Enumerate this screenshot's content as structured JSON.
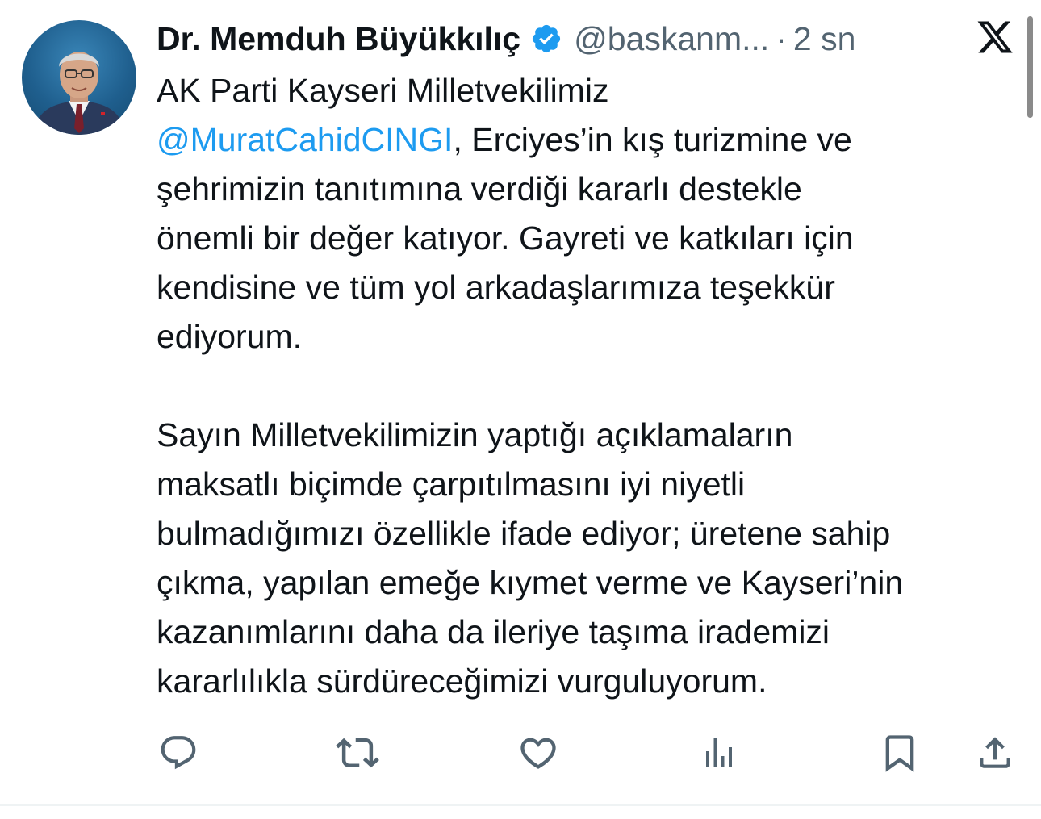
{
  "tweet": {
    "author": {
      "display_name": "Dr. Memduh Büyükkılıç",
      "handle": "@baskanm...",
      "separator": "·",
      "time": "2 sn"
    },
    "lines": {
      "l1": "AK Parti Kayseri Milletvekilimiz",
      "l2_mention": "@MuratCahidCINGI",
      "l2_rest": ", Erciyes’in kış turizmine ve",
      "l3": "şehrimizin tanıtımına verdiği kararlı destekle",
      "l4": "önemli bir değer katıyor. Gayreti ve katkıları için",
      "l5": "kendisine ve tüm yol arkadaşlarımıza teşekkür",
      "l6": "ediyorum.",
      "l7": "Sayın Milletvekilimizin yaptığı açıklamaların",
      "l8": "maksatlı biçimde çarpıtılmasını iyi niyetli",
      "l9": "bulmadığımızı özellikle ifade ediyor; üretene sahip",
      "l10": "çıkma, yapılan emeğe kıymet verme ve Kayseri’nin",
      "l11": "kazanımlarını daha da ileriye taşıma irademizi",
      "l12": "kararlılıkla sürdüreceğimizi vurguluyorum."
    }
  },
  "icons": {
    "verified": "verified-badge-icon",
    "brand": "x-logo-icon",
    "actions": [
      "reply-icon",
      "retweet-icon",
      "like-icon",
      "views-icon",
      "bookmark-icon",
      "share-icon"
    ]
  },
  "colors": {
    "text": "#0f1419",
    "secondary": "#536471",
    "accent": "#1d9bf0",
    "icon": "#536471"
  }
}
